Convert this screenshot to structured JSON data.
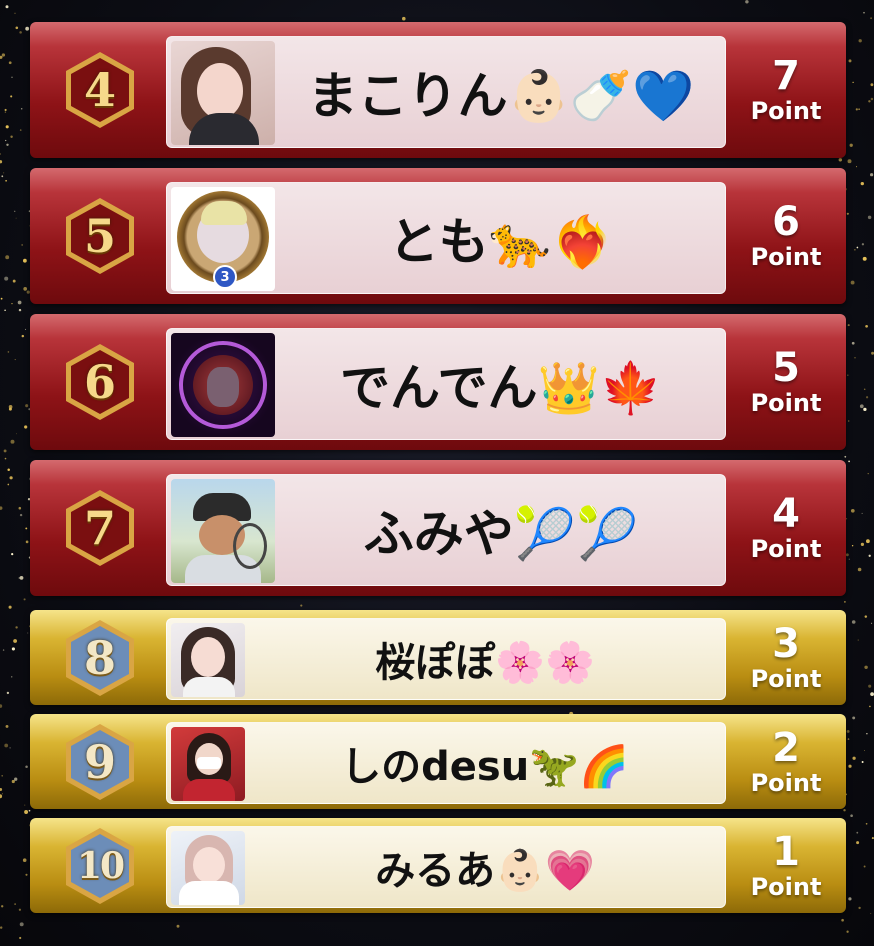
{
  "ranking": [
    {
      "rank": "4",
      "name": "まこりん👶🏻🍼💙",
      "points": "7",
      "unit": "Point",
      "tier": "red"
    },
    {
      "rank": "5",
      "name": "とも🐆❤️‍🔥",
      "points": "6",
      "unit": "Point",
      "tier": "red"
    },
    {
      "rank": "6",
      "name": "でんでん👑🍁",
      "points": "5",
      "unit": "Point",
      "tier": "red"
    },
    {
      "rank": "7",
      "name": "ふみや🎾🎾",
      "points": "4",
      "unit": "Point",
      "tier": "red"
    },
    {
      "rank": "8",
      "name": "桜ぽぽ🌸🌸",
      "points": "3",
      "unit": "Point",
      "tier": "gold"
    },
    {
      "rank": "9",
      "name": "しのdesu🦖🌈",
      "points": "2",
      "unit": "Point",
      "tier": "gold"
    },
    {
      "rank": "10",
      "name": "みるあ👶🏻💗",
      "points": "1",
      "unit": "Point",
      "tier": "gold"
    }
  ],
  "avatar_badge_number": "3",
  "colors": {
    "red_band": "#8e1317",
    "gold_band": "#d9b432",
    "badge_red": "#7a0f10",
    "badge_blue": "#6c8db8",
    "badge_gold_border": "#d9a544"
  }
}
